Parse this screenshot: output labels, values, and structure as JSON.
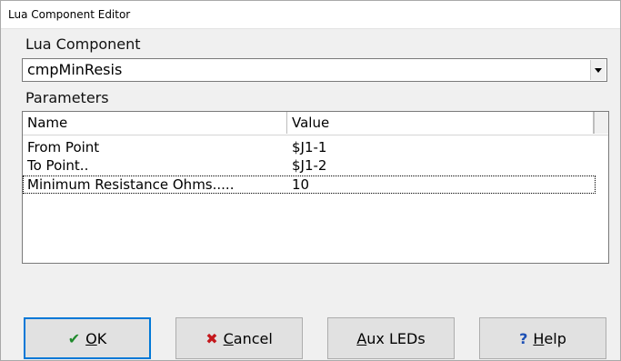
{
  "window": {
    "title": "Lua Component Editor"
  },
  "component": {
    "label": "Lua Component",
    "selected": "cmpMinResis"
  },
  "parameters": {
    "label": "Parameters",
    "columns": [
      "Name",
      "Value"
    ],
    "rows": [
      {
        "name": "From Point",
        "value": "$J1-1"
      },
      {
        "name": "To Point..",
        "value": "$J1-2"
      },
      {
        "name": "Minimum Resistance Ohms.....",
        "value": "10"
      }
    ]
  },
  "buttons": {
    "ok": {
      "accel": "O",
      "rest": "K"
    },
    "cancel": {
      "accel": "C",
      "rest": "ancel"
    },
    "aux": {
      "accel": "A",
      "rest": "ux LEDs"
    },
    "help": {
      "accel": "H",
      "rest": "elp"
    }
  },
  "icons": {
    "ok": "check-icon",
    "cancel": "x-icon",
    "help": "question-icon"
  }
}
